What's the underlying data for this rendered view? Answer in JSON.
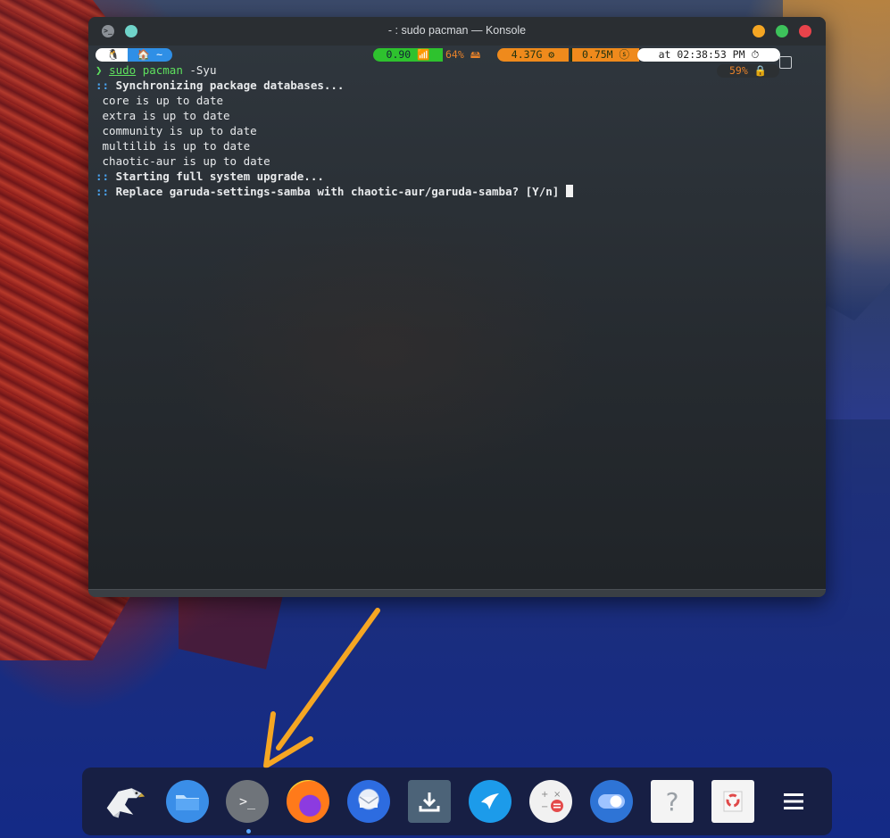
{
  "window": {
    "title": "- : sudo pacman — Konsole"
  },
  "prompt_bar": {
    "os_glyph": "🐧",
    "dir": "🏠 ~",
    "load": "0.90 📶",
    "disk": "64% 🖴",
    "ram": "4.37G ⚙",
    "swap": "0.75M ⓢ",
    "time": "at 02:38:53 PM ⏱",
    "battery": "59% 🔒"
  },
  "terminal": {
    "prompt_symbol": "❯",
    "command_sudo": "sudo",
    "command_pacman": "pacman",
    "command_args": " -Syu",
    "lines": [
      ":: ",
      "Synchronizing package databases...",
      "core is up to date",
      "extra is up to date",
      "community is up to date",
      "multilib is up to date",
      "chaotic-aur is up to date",
      ":: ",
      "Starting full system upgrade...",
      ":: ",
      "Replace garuda-settings-samba with chaotic-aur/garuda-samba? [Y/n] "
    ]
  },
  "dock": {
    "items": [
      {
        "name": "garuda-eagle-icon"
      },
      {
        "name": "file-manager-icon"
      },
      {
        "name": "terminal-icon",
        "glyph": ">_"
      },
      {
        "name": "firefox-icon"
      },
      {
        "name": "thunderbird-icon"
      },
      {
        "name": "downloader-icon"
      },
      {
        "name": "kdeconnect-icon"
      },
      {
        "name": "calculator-icon"
      },
      {
        "name": "toggle-settings-icon"
      },
      {
        "name": "help-icon",
        "glyph": "?"
      },
      {
        "name": "recycle-icon"
      },
      {
        "name": "menu-icon"
      }
    ]
  },
  "colors": {
    "accent_arrow": "#f5a623",
    "terminal_bg": "#2b2f34",
    "prompt_green": "#2ec22e",
    "prompt_orange": "#ef8a1c",
    "prompt_blue": "#2f8fe6"
  }
}
